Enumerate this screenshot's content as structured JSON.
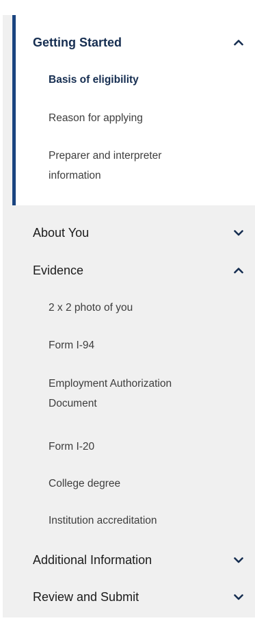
{
  "nav": {
    "sections": [
      {
        "title": "Getting Started",
        "expanded": true,
        "chevron": "chevron-up-icon",
        "items": [
          {
            "label": "Basis of eligibility",
            "current": true
          },
          {
            "label": "Reason for applying"
          },
          {
            "label": "Preparer and interpreter information"
          }
        ]
      },
      {
        "title": "About You",
        "expanded": false,
        "chevron": "chevron-down-icon"
      },
      {
        "title": "Evidence",
        "expanded": true,
        "chevron": "chevron-up-icon",
        "items": [
          {
            "label": "2 x 2 photo of you"
          },
          {
            "label": "Form I-94"
          },
          {
            "label": "Employment Authorization Document"
          },
          {
            "label": "Form I-20"
          },
          {
            "label": "College degree"
          },
          {
            "label": "Institution accreditation"
          }
        ]
      },
      {
        "title": "Additional Information",
        "expanded": false,
        "chevron": "chevron-down-icon"
      },
      {
        "title": "Review and Submit",
        "expanded": false,
        "chevron": "chevron-down-icon"
      }
    ]
  },
  "colors": {
    "accent": "#1a4480",
    "active_text": "#162e51",
    "panel_bg": "#f0f0f0",
    "active_bg": "#ffffff"
  }
}
